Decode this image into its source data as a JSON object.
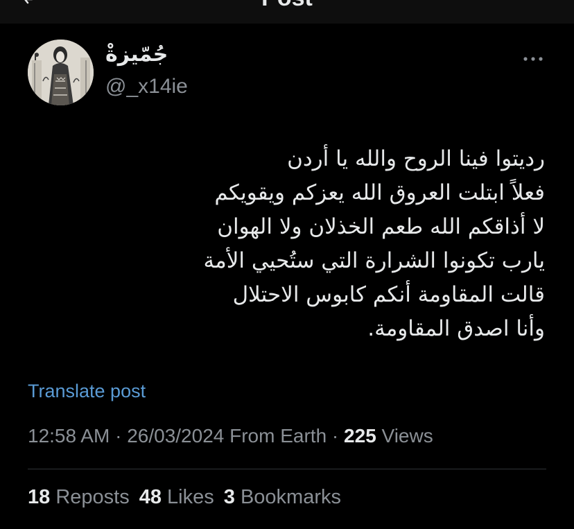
{
  "header": {
    "title": "Post",
    "back_icon": "back-arrow-icon"
  },
  "author": {
    "display_name": "جُمّيزةْ",
    "handle": "@_x14ie",
    "avatar": "avatar-illustration"
  },
  "more_icon": "more-horizontal-icon",
  "tweet": {
    "text": "رديتوا فينا الروح والله يا أردن\nفعلاً ابتلت العروق الله يعزكم ويقويكم\nلا أذاقكم الله طعم الخذلان ولا الهوان\nيارب تكونوا الشرارة التي ستُحيي الأمة\nقالت المقاومة أنكم كابوس الاحتلال\nوأنا اصدق المقاومة."
  },
  "translate_label": "Translate post",
  "meta": {
    "time": "12:58 AM",
    "sep1": " · ",
    "date": "26/03/2024",
    "location": " From Earth",
    "sep2": " · ",
    "views_count": "225",
    "views_label": " Views"
  },
  "stats": {
    "reposts_count": "18",
    "reposts_label": " Reposts",
    "likes_count": "48",
    "likes_label": " Likes",
    "bookmarks_count": "3",
    "bookmarks_label": " Bookmarks"
  },
  "colors": {
    "background": "#000000",
    "text_primary": "#e7e9ea",
    "text_secondary": "#8b9096",
    "link": "#5a9bd5",
    "divider": "#2f3336"
  }
}
